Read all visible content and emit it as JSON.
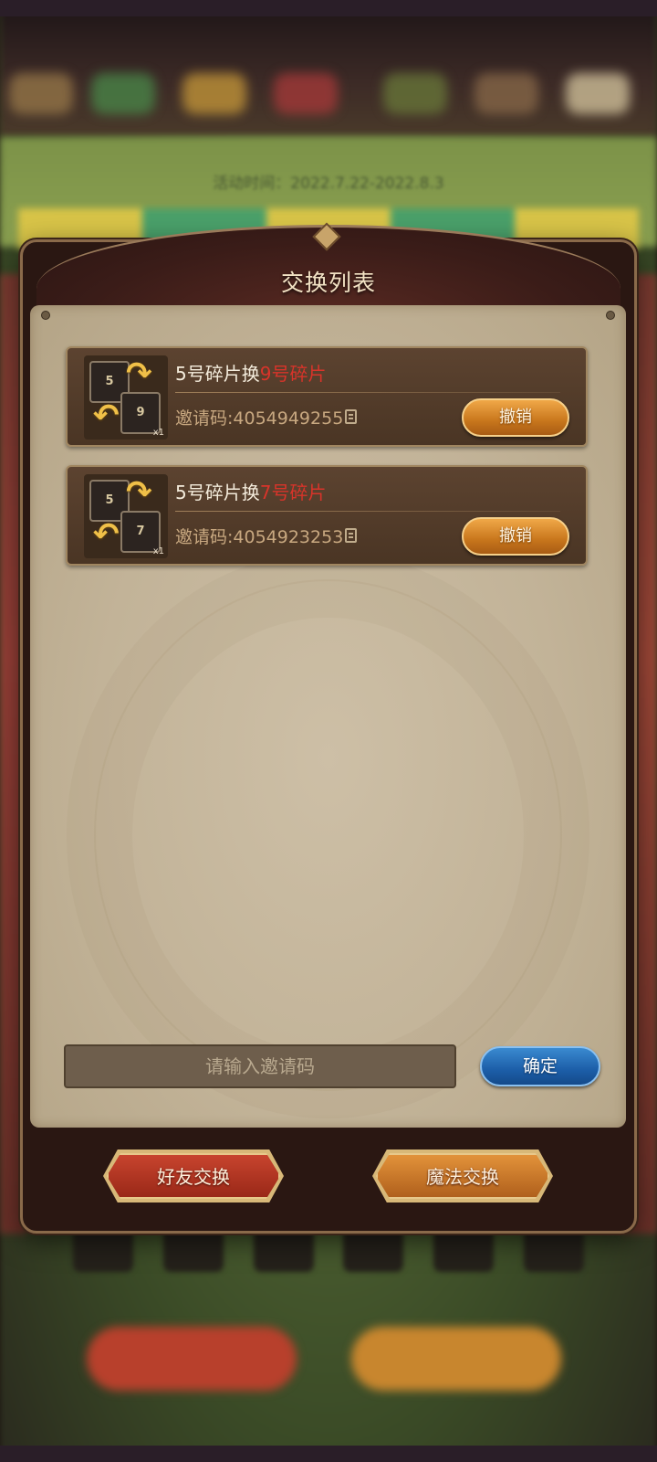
{
  "background": {
    "activity_time": "活动时间：2022.7.22-2022.8.3"
  },
  "dialog": {
    "title": "交换列表",
    "trades": [
      {
        "give": "5号碎片换",
        "receive": "9号碎片",
        "give_card": "5",
        "receive_card": "9",
        "quantity": "x1",
        "invite_code": "邀请码:4054949255",
        "cancel_label": "撤销"
      },
      {
        "give": "5号碎片换",
        "receive": "7号碎片",
        "give_card": "5",
        "receive_card": "7",
        "quantity": "x1",
        "invite_code": "邀请码:4054923253",
        "cancel_label": "撤销"
      }
    ],
    "input": {
      "placeholder": "请输入邀请码",
      "value": ""
    },
    "confirm_label": "确定",
    "tabs": [
      {
        "label": "好友交换"
      },
      {
        "label": "魔法交换"
      }
    ]
  },
  "colors": {
    "highlight_red": "#d8342a",
    "cancel_orange": "#c8761c",
    "confirm_blue": "#1c5ea8"
  },
  "icons": [
    "copy-icon",
    "swap-arrow-icon",
    "fragment-card-icon"
  ]
}
